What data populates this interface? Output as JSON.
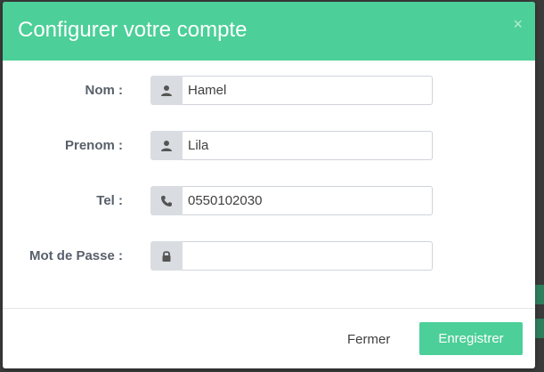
{
  "modal": {
    "title": "Configurer votre compte",
    "close_glyph": "×"
  },
  "form": {
    "fields": [
      {
        "label": "Nom :",
        "value": "Hamel",
        "icon": "user-icon"
      },
      {
        "label": "Prenom :",
        "value": "Lila",
        "icon": "user-icon"
      },
      {
        "label": "Tel :",
        "value": "0550102030",
        "icon": "phone-icon"
      },
      {
        "label": "Mot de Passe :",
        "value": "",
        "icon": "lock-icon"
      }
    ]
  },
  "footer": {
    "close_label": "Fermer",
    "save_label": "Enregistrer"
  },
  "colors": {
    "header": "#4ccf98",
    "primary_button": "#4ccf98",
    "addon_bg": "#d9dde2",
    "label_text": "#58606b"
  }
}
